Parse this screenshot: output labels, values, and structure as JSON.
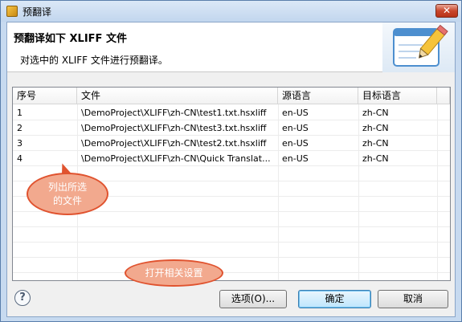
{
  "window": {
    "title": "预翻译",
    "close_glyph": "✕"
  },
  "banner": {
    "title": "预翻译如下 XLIFF 文件",
    "description": "对选中的 XLIFF 文件进行预翻译。",
    "image_icon": "pencil-notepad-icon"
  },
  "table": {
    "headers": {
      "no": "序号",
      "file": "文件",
      "source_lang": "源语言",
      "target_lang": "目标语言"
    },
    "rows": [
      {
        "no": "1",
        "file": "\\DemoProject\\XLIFF\\zh-CN\\test1.txt.hsxliff",
        "source_lang": "en-US",
        "target_lang": "zh-CN"
      },
      {
        "no": "2",
        "file": "\\DemoProject\\XLIFF\\zh-CN\\test3.txt.hsxliff",
        "source_lang": "en-US",
        "target_lang": "zh-CN"
      },
      {
        "no": "3",
        "file": "\\DemoProject\\XLIFF\\zh-CN\\test2.txt.hsxliff",
        "source_lang": "en-US",
        "target_lang": "zh-CN"
      },
      {
        "no": "4",
        "file": "\\DemoProject\\XLIFF\\zh-CN\\Quick Translat...",
        "source_lang": "en-US",
        "target_lang": "zh-CN"
      }
    ]
  },
  "callouts": {
    "list_files": "列出所选\n的文件",
    "open_settings": "打开相关设置"
  },
  "footer": {
    "help_glyph": "?",
    "options_label": "选项(O)...",
    "ok_label": "确定",
    "cancel_label": "取消"
  },
  "colors": {
    "callout_fill": "#f2a98e",
    "callout_border": "#e0532f",
    "titlebar": "#c7daf0"
  }
}
